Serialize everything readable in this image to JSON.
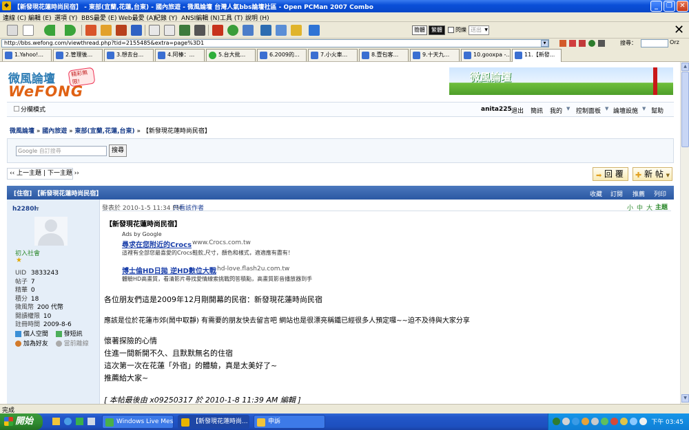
{
  "window": {
    "title": "【新發現花蓮時尚民宿】 - 東部(宜蘭,花蓮,台東) - 國內旅遊 - 微風論壇 台灣人氣bbs論壇社區 - Open PCMan 2007 Combo"
  },
  "menu": [
    "連線 (C)",
    "編輯 (E)",
    "選項 (Y)",
    "BBS最愛 (E)",
    "Web最愛 (A)",
    "紀錄 (Y)",
    "ANSI編輯 (N)",
    "工具 (T)",
    "說明 (H)"
  ],
  "toolbar": {
    "simplified": "簡體",
    "traditional": "繁體",
    "blink": "閃爍",
    "send": "送出"
  },
  "address": {
    "url": "http://bbs.wefong.com/viewthread.php?tid=2155485&extra=page%3D1"
  },
  "search_bar": {
    "label": "搜尋：",
    "engine": "Orz"
  },
  "tabs": [
    "1.Yahoo!...",
    "2.管理後...",
    "3.想去台...",
    "4.阿榛：...",
    "5.台大批...",
    "6.2009的...",
    "7.小火車...",
    "8.壹包客...",
    "9.十天九...",
    "10.gooxpa -...",
    "11.【新發..."
  ],
  "site": {
    "logo_top": "微風論壇",
    "logo_bottom": "WeFONG",
    "logo_badge": "精彩無限!",
    "banner_text": "微風論壇",
    "split_mode": "分欄模式",
    "user": "anita225",
    "nav": [
      "退出",
      "簡訊",
      "我的",
      "控制面板",
      "論壇設施",
      "幫助"
    ],
    "breadcrumb": [
      "微風論壇",
      "國內旅遊",
      "東部(宜蘭,花蓮,台東)",
      "【新發現花蓮時尚民宿】"
    ],
    "search_placeholder": "自訂搜尋",
    "google_label": "Google",
    "search_button": "搜尋",
    "prev_topic": "‹‹ 上一主題",
    "next_topic": "下一主題 ››",
    "reply_button": "回 覆",
    "new_post_button": "新 帖",
    "thread_title": "[住宿] 【新發現花蓮時尚民宿】",
    "thread_actions": [
      "收藏",
      "訂閱",
      "推薦",
      "列印"
    ]
  },
  "author": {
    "name": "h2280h",
    "rank": "初入社會",
    "stats": [
      {
        "label": "UID",
        "value": "3833243"
      },
      {
        "label": "帖子",
        "value": "7"
      },
      {
        "label": "精華",
        "value": "0"
      },
      {
        "label": "積分",
        "value": "18"
      },
      {
        "label": "微風幣",
        "value": "200 代幣"
      },
      {
        "label": "閱讀權限",
        "value": "10"
      },
      {
        "label": "註冊時間",
        "value": "2009-8-6"
      }
    ],
    "actions": [
      "個人空間",
      "發短訊",
      "加為好友",
      "當前離線"
    ]
  },
  "post": {
    "meta": "發表於 2010-1-5 11:34 PM",
    "only_author": "只看該作者",
    "size_controls": [
      "小",
      "中",
      "大"
    ],
    "floor": "主題",
    "title": "【新發現花蓮時尚民宿】",
    "ads_label": "Ads by Google",
    "ad1": {
      "title": "尋求在您附近的Crocs",
      "url": "www.Crocs.com.tw",
      "desc": "這裡有全部您最喜愛的Crocs鞋款,尺寸，顏色和樣式，適適應有盡有！"
    },
    "ad2": {
      "title": "博士倫HD日拋 逆HD數位大戰",
      "url": "hd-love.flash2u.com.tw",
      "desc": "體驗HD高畫質，看清影片尋找愛情線索挑戰閃答積點，高畫質影音播放器到手"
    },
    "lines": [
      "各位朋友們這是2009年12月剛開幕的民宿：新發現花蓮時尚民宿",
      "應該是位於花蓮市郊(鬧中取靜) 有需要的朋友快去留言吧 網站也是很漂亮稱鐵已經很多人預定囉~~迫不及待與大家分享",
      "懷著探險的心情",
      "住進一間新開不久、且默默無名的住宿",
      "這次第一次在花蓮「外宿」的體驗，真是太美好了~",
      "推薦給大家~"
    ],
    "edit_note": "[ 本帖最後由 x09250317 於 2010-1-8 11:39 AM 編輯 ]"
  },
  "status": {
    "text": "完成"
  },
  "taskbar": {
    "start": "開始",
    "tasks": [
      "Windows Live Messen...",
      "【新發現花蓮時尚...",
      "申訴"
    ],
    "clock": "下午 03:45"
  }
}
